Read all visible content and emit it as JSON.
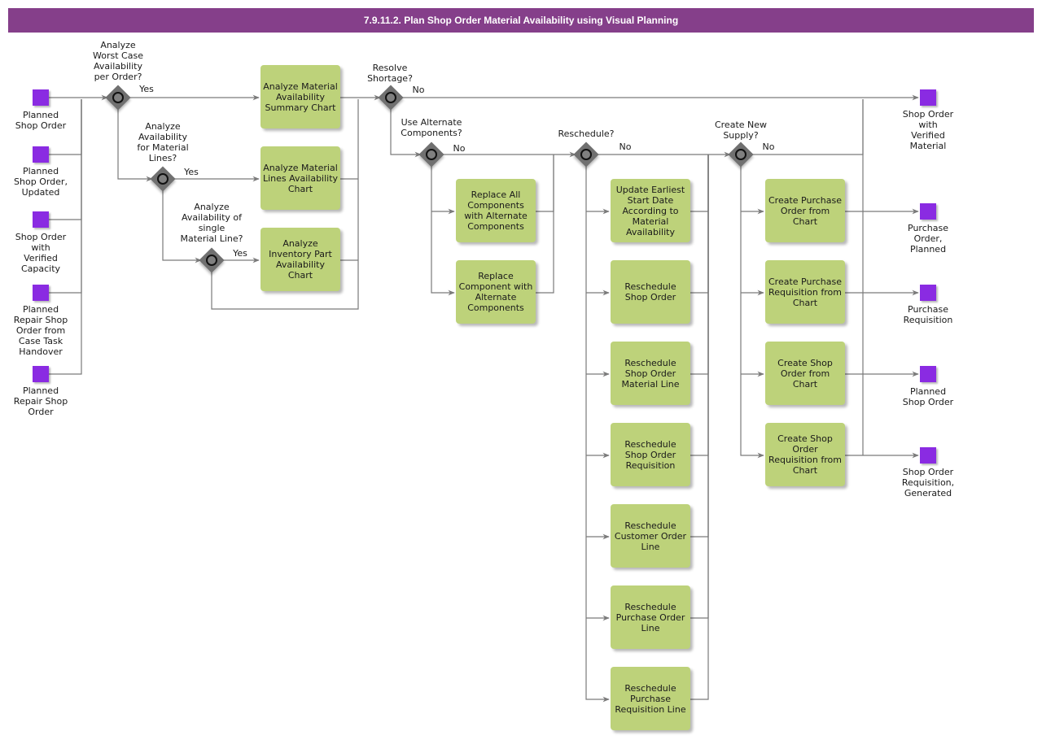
{
  "title": "7.9.11.2. Plan Shop Order Material Availability using Visual Planning",
  "colors": {
    "title_bar": "#853f8a",
    "task": "#bdd27a",
    "event": "#8a2be2",
    "gateway": "#707070",
    "line": "#7a7a7a"
  },
  "start_events": [
    {
      "label": "Planned\nShop Order"
    },
    {
      "label": "Planned\nShop Order,\nUpdated"
    },
    {
      "label": "Shop Order\nwith\nVerified\nCapacity"
    },
    {
      "label": "Planned\nRepair Shop\nOrder from\nCase Task\nHandover"
    },
    {
      "label": "Planned\nRepair Shop\nOrder"
    }
  ],
  "gateways": [
    {
      "id": "g1",
      "question": "Analyze\nWorst Case\nAvailability\nper Order?",
      "branch": "Yes"
    },
    {
      "id": "g2",
      "question": "Analyze\nAvailability\nfor Material\nLines?",
      "branch": "Yes"
    },
    {
      "id": "g3",
      "question": "Analyze\nAvailability of\nsingle\nMaterial Line?",
      "branch": "Yes"
    },
    {
      "id": "g4",
      "question": "Resolve\nShortage?",
      "branch": "No"
    },
    {
      "id": "g5",
      "question": "Use Alternate\nComponents?",
      "branch": "No"
    },
    {
      "id": "g6",
      "question": "Reschedule?",
      "branch": "No"
    },
    {
      "id": "g7",
      "question": "Create New\nSupply?",
      "branch": "No"
    }
  ],
  "tasks": {
    "analyze": [
      "Analyze Material\nAvailability\nSummary Chart",
      "Analyze Material\nLines Availability\nChart",
      "Analyze\nInventory Part\nAvailability\nChart"
    ],
    "alternate": [
      "Replace All\nComponents\nwith Alternate\nComponents",
      "Replace\nComponent with\nAlternate\nComponents"
    ],
    "reschedule": [
      "Update Earliest\nStart Date\nAccording to\nMaterial\nAvailability",
      "Reschedule\nShop Order",
      "Reschedule\nShop Order\nMaterial Line",
      "Reschedule\nShop Order\nRequisition",
      "Reschedule\nCustomer Order\nLine",
      "Reschedule\nPurchase Order\nLine",
      "Reschedule\nPurchase\nRequisition Line"
    ],
    "supply": [
      "Create Purchase\nOrder from\nChart",
      "Create Purchase\nRequisition from\nChart",
      "Create Shop\nOrder from\nChart",
      "Create Shop\nOrder\nRequisition from\nChart"
    ]
  },
  "end_events": [
    {
      "label": "Shop Order\nwith\nVerified\nMaterial"
    },
    {
      "label": "Purchase\nOrder,\nPlanned"
    },
    {
      "label": "Purchase\nRequisition"
    },
    {
      "label": "Planned\nShop Order"
    },
    {
      "label": "Shop Order\nRequisition,\nGenerated"
    }
  ]
}
